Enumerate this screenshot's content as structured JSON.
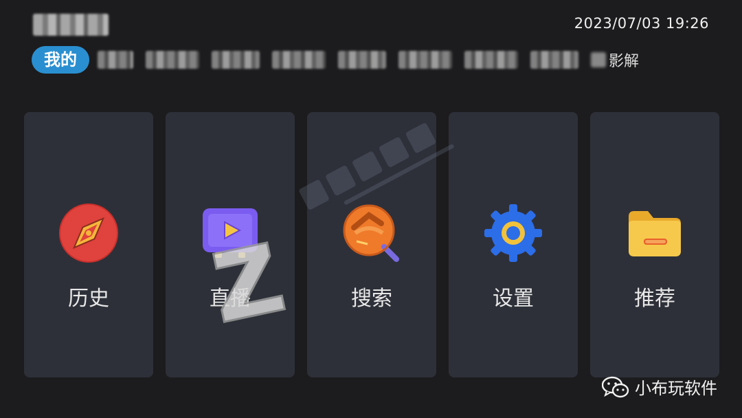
{
  "header": {
    "clock": "2023/07/03 19:26"
  },
  "tabs": {
    "active_label": "我的",
    "last_partial_label": "影解"
  },
  "cards": [
    {
      "label": "历史",
      "icon": "compass-icon"
    },
    {
      "label": "直播",
      "icon": "play-video-icon"
    },
    {
      "label": "搜索",
      "icon": "search-icon"
    },
    {
      "label": "设置",
      "icon": "gear-icon"
    },
    {
      "label": "推荐",
      "icon": "folder-icon"
    }
  ],
  "watermark": {
    "account": "小布玩软件"
  },
  "colors": {
    "background": "#1c1c1e",
    "card": "#2e3039",
    "accent_tab": "#2a8fd0"
  }
}
